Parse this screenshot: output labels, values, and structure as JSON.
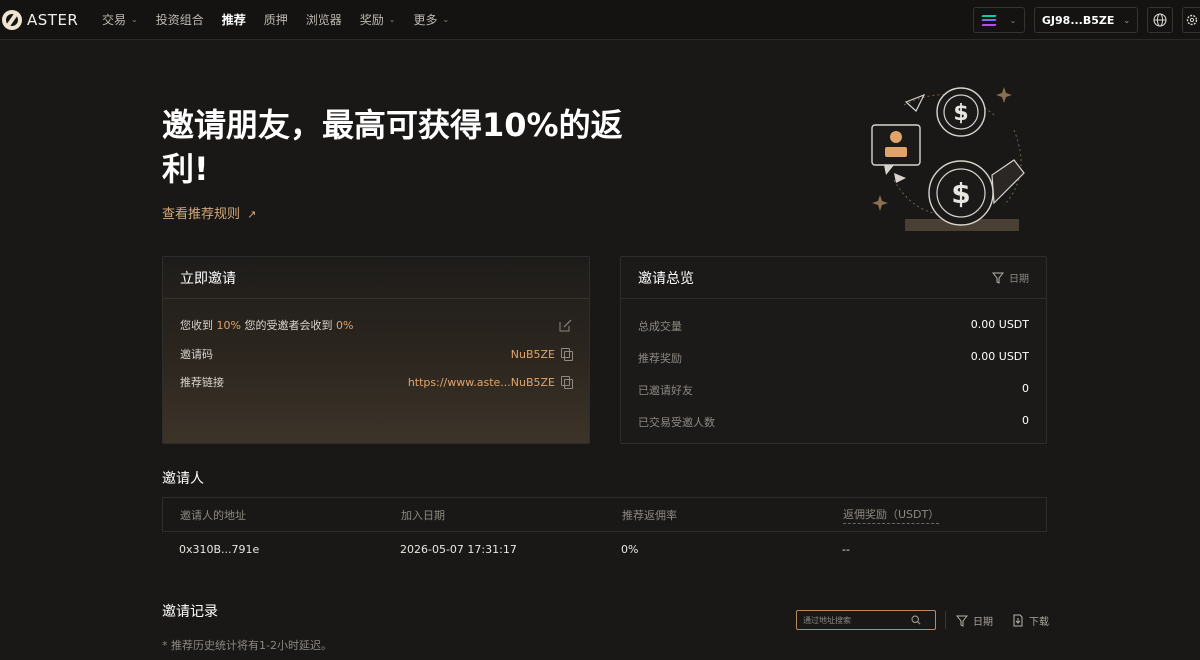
{
  "header": {
    "logo_text": "ASTER",
    "nav": [
      {
        "label": "交易",
        "dropdown": true
      },
      {
        "label": "投资组合",
        "dropdown": false
      },
      {
        "label": "推荐",
        "dropdown": false,
        "active": true
      },
      {
        "label": "质押",
        "dropdown": false
      },
      {
        "label": "浏览器",
        "dropdown": false
      },
      {
        "label": "奖励",
        "dropdown": true
      },
      {
        "label": "更多",
        "dropdown": true
      }
    ],
    "wallet_address": "GJ98...B5ZE"
  },
  "hero": {
    "title": "邀请朋友，最高可获得10%的返利!",
    "rules_link": "查看推荐规则"
  },
  "invite_card": {
    "title": "立即邀请",
    "rate_prefix": "您收到",
    "my_rate": "10%",
    "rate_middle": "您的受邀者会收到",
    "invitee_rate": "0%",
    "code_label": "邀请码",
    "code_value": "NuB5ZE",
    "link_label": "推荐链接",
    "link_value": "https://www.aste...NuB5ZE"
  },
  "overview_card": {
    "title": "邀请总览",
    "filter_label": "日期",
    "rows": [
      {
        "label": "总成交量",
        "value": "0.00 USDT"
      },
      {
        "label": "推荐奖励",
        "value": "0.00 USDT"
      },
      {
        "label": "已邀请好友",
        "value": "0"
      },
      {
        "label": "已交易受邀人数",
        "value": "0"
      }
    ]
  },
  "inviter_section": {
    "title": "邀请人",
    "columns": [
      "邀请人的地址",
      "加入日期",
      "推荐返佣率",
      "返佣奖励（USDT）"
    ],
    "rows": [
      {
        "address": "0x310B...791e",
        "join_date": "2026-05-07 17:31:17",
        "rate": "0%",
        "reward": "--"
      }
    ]
  },
  "records_section": {
    "title": "邀请记录",
    "search_placeholder": "通过地址搜索",
    "date_filter": "日期",
    "download": "下载",
    "note": "* 推荐历史统计将有1-2小时延迟。"
  },
  "colors": {
    "accent": "#e0a46a",
    "background": "#191817",
    "card_border": "#2f2d2a"
  }
}
